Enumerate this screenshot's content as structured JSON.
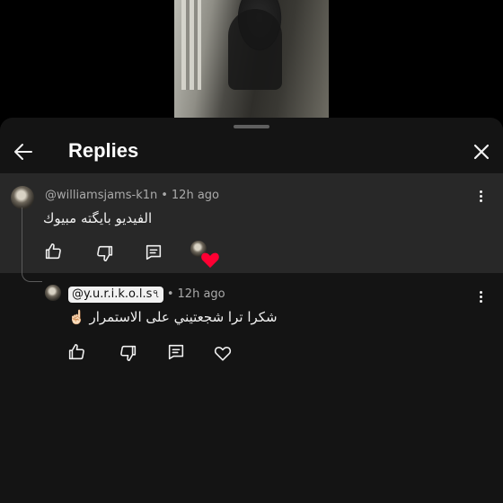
{
  "header": {
    "title": "Replies"
  },
  "parent_comment": {
    "author": "@williamsjams-k1n",
    "separator": "•",
    "time": "12h ago",
    "text": "الفيديو بايگته مبيوك"
  },
  "reply": {
    "author": "@y.u.r.i.k.o.l.s৭",
    "separator": "•",
    "time": "12h ago",
    "text": "شكرا ترا شجعتيني على الاستمرار",
    "emoji": "☝🏻"
  },
  "colors": {
    "sheet_bg": "#141414",
    "parent_bg": "#282828",
    "heart": "#ff0033",
    "text": "#f1f1f1",
    "muted": "#aaaaaa"
  },
  "icons": [
    "back-arrow-icon",
    "close-icon",
    "like-icon",
    "dislike-icon",
    "reply-icon",
    "heart-icon",
    "more-vertical-icon"
  ]
}
